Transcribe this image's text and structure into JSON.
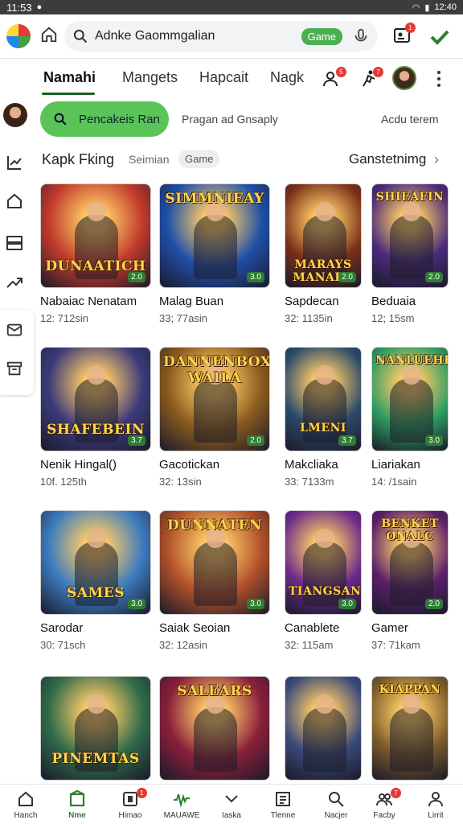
{
  "status_bar": {
    "time": "11:53",
    "clock": "12:40"
  },
  "search": {
    "value": "Adnke Gaommgalian",
    "chip": "Game"
  },
  "tabs": [
    {
      "label": "Namahi",
      "active": true
    },
    {
      "label": "Mangets"
    },
    {
      "label": "Hapcait"
    },
    {
      "label": "Nagk"
    }
  ],
  "badges": {
    "people": "5",
    "runner": "7",
    "bottom_notif": "1",
    "bottom_feed": "7",
    "top_profile": "1"
  },
  "filters": {
    "primary": "Pencakeis Ran",
    "secondary": "Pragan ad Gnsaply",
    "right": "Acdu terem"
  },
  "section": {
    "title": "Kapk Fking",
    "subtitle": "Seimian",
    "chip": "Game",
    "action": "Ganstetnimg",
    "chevron": "›"
  },
  "games": [
    {
      "name": "Nabaiac Nenatam",
      "meta": "12: 712sin",
      "art_title": "DUNAATICH",
      "rating": "2.0",
      "bg": "#c0392b"
    },
    {
      "name": "Malag Buan",
      "meta": "33; 77asin",
      "art_title": "SIMMNIEAY",
      "rating": "3.0",
      "bg": "#1f4fa8"
    },
    {
      "name": "Sapdecan",
      "meta": "32: 1135in",
      "art_title": "MARAYS MANARE",
      "rating": "2.0",
      "bg": "#7a2f1a"
    },
    {
      "name": "Beduaia",
      "meta": "12; 15sm",
      "art_title": "SHIEAFIN",
      "rating": "2.0",
      "bg": "#4a2a7a"
    },
    {
      "name": "Nenik Hingal()",
      "meta": "10f. 125th",
      "art_title": "SHAFEBEIN",
      "rating": "3.7",
      "bg": "#3b3a7a"
    },
    {
      "name": "Gacotickan",
      "meta": "32: 13sin",
      "art_title": "DANNENBOX WAILA",
      "rating": "2.0",
      "bg": "#8a5a1e"
    },
    {
      "name": "Makcliaka",
      "meta": "33: 7133m",
      "art_title": "LMENI",
      "rating": "3.7",
      "bg": "#2c4a6a"
    },
    {
      "name": "Liariakan",
      "meta": "14: /1sain",
      "art_title": "NANLUEHEN",
      "rating": "3.0",
      "bg": "#2e9c62"
    },
    {
      "name": "Sarodar",
      "meta": "30: 71sch",
      "art_title": "SAMES",
      "rating": "3.0",
      "bg": "#3b7bbf"
    },
    {
      "name": "Saiak Seoian",
      "meta": "32: 12asin",
      "art_title": "DUNNATEN",
      "rating": "3.0",
      "bg": "#b0502a"
    },
    {
      "name": "Canablete",
      "meta": "32: 115am",
      "art_title": "TIANGSAN",
      "rating": "3.0",
      "bg": "#6a2a8a"
    },
    {
      "name": "Gamer",
      "meta": "37: 71kam",
      "art_title": "BENKET ONALC",
      "rating": "2.0",
      "bg": "#5a1f6a"
    },
    {
      "name": "",
      "meta": "",
      "art_title": "PINEMTAS",
      "rating": "",
      "bg": "#2f6b4a"
    },
    {
      "name": "",
      "meta": "",
      "art_title": "SALEARS",
      "rating": "",
      "bg": "#8a1f3a"
    },
    {
      "name": "",
      "meta": "",
      "art_title": "",
      "rating": "",
      "bg": "#3a4a7a"
    },
    {
      "name": "",
      "meta": "",
      "art_title": "KIAPPAN",
      "rating": "",
      "bg": "#7a5a2a"
    }
  ],
  "bottom_nav": [
    {
      "label": "Hanch",
      "icon": "home-icon"
    },
    {
      "label": "Nme",
      "icon": "store-icon",
      "active": true
    },
    {
      "label": "Himao",
      "icon": "notification-icon"
    },
    {
      "label": "MAUAWE",
      "icon": "activity-icon"
    },
    {
      "label": "Iaska",
      "icon": "chevron-down-icon"
    },
    {
      "label": "Tlenne",
      "icon": "list-icon"
    },
    {
      "label": "Nacjer",
      "icon": "search-icon"
    },
    {
      "label": "Facby",
      "icon": "group-icon"
    },
    {
      "label": "Lirrit",
      "icon": "user-icon"
    }
  ],
  "colors": {
    "accent_green": "#4caf50",
    "tab_underline": "#1b5e20",
    "badge_red": "#e53935"
  }
}
